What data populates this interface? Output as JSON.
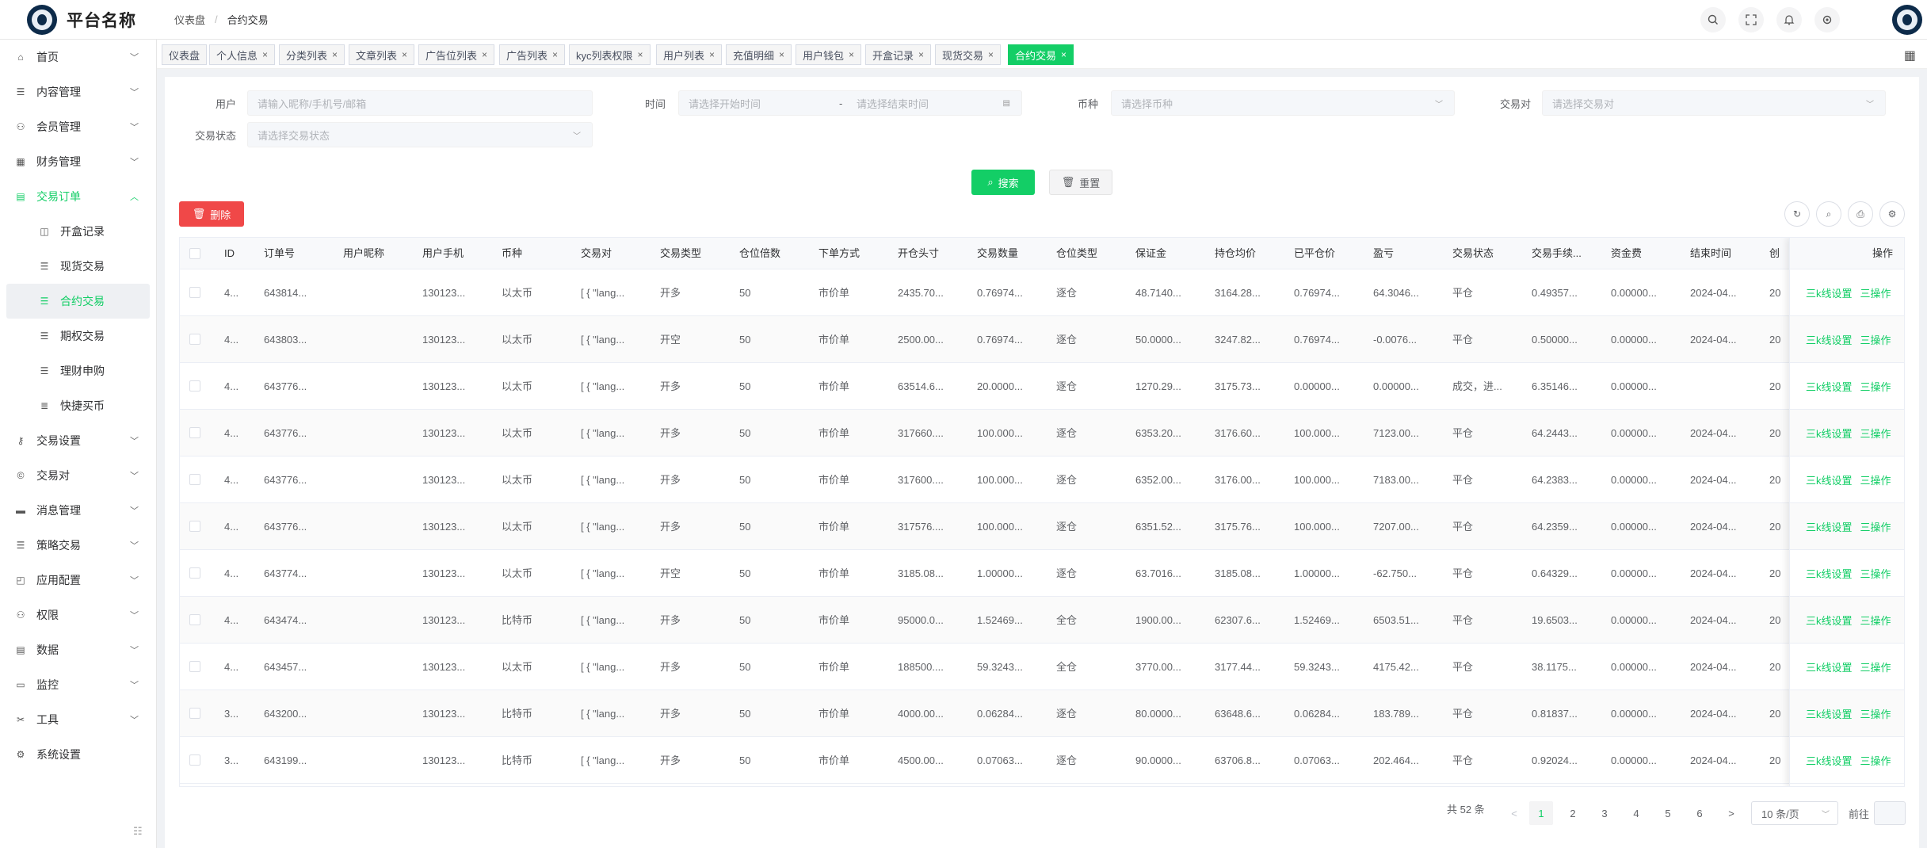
{
  "header": {
    "brand": "平台名称",
    "breadcrumb": [
      "仪表盘",
      "合约交易"
    ],
    "icons": [
      "search-icon",
      "fullscreen-icon",
      "bell-icon",
      "settings-icon"
    ]
  },
  "sidebar": {
    "items": [
      {
        "label": "首页",
        "icon": "home-icon",
        "arrow": "v"
      },
      {
        "label": "内容管理",
        "icon": "list-icon",
        "arrow": "v"
      },
      {
        "label": "会员管理",
        "icon": "user-icon",
        "arrow": "v"
      },
      {
        "label": "财务管理",
        "icon": "finance-icon",
        "arrow": "v"
      },
      {
        "label": "交易订单",
        "icon": "order-icon",
        "arrow": "^"
      }
    ],
    "sub_items": [
      {
        "label": "开盒记录",
        "icon": "box-icon"
      },
      {
        "label": "现货交易",
        "icon": "list-icon"
      },
      {
        "label": "合约交易",
        "icon": "list-icon"
      },
      {
        "label": "期权交易",
        "icon": "list-icon"
      },
      {
        "label": "理财申购",
        "icon": "list-icon"
      },
      {
        "label": "快捷买币",
        "icon": "bars-icon"
      }
    ],
    "items_after": [
      {
        "label": "交易设置",
        "icon": "key-icon",
        "arrow": "v"
      },
      {
        "label": "交易对",
        "icon": "coin-icon",
        "arrow": "v"
      },
      {
        "label": "消息管理",
        "icon": "message-icon",
        "arrow": "v"
      },
      {
        "label": "策略交易",
        "icon": "list-icon",
        "arrow": "v"
      },
      {
        "label": "应用配置",
        "icon": "app-icon",
        "arrow": "v"
      },
      {
        "label": "权限",
        "icon": "permission-icon",
        "arrow": "v"
      },
      {
        "label": "数据",
        "icon": "data-icon",
        "arrow": "v"
      },
      {
        "label": "监控",
        "icon": "monitor-icon",
        "arrow": "v"
      },
      {
        "label": "工具",
        "icon": "tool-icon",
        "arrow": "v"
      },
      {
        "label": "系统设置",
        "icon": "gear-icon",
        "arrow": ""
      }
    ]
  },
  "tags": [
    "仪表盘",
    "个人信息",
    "分类列表",
    "文章列表",
    "广告位列表",
    "广告列表",
    "kyc列表权限",
    "用户列表",
    "充值明细",
    "用户钱包",
    "开盒记录",
    "现货交易",
    "合约交易"
  ],
  "filters": {
    "user_label": "用户",
    "user_placeholder": "请输入昵称/手机号/邮箱",
    "time_label": "时间",
    "time_start": "请选择开始时间",
    "time_sep": "-",
    "time_end": "请选择结束时间",
    "coin_label": "币种",
    "coin_placeholder": "请选择币种",
    "pair_label": "交易对",
    "pair_placeholder": "请选择交易对",
    "status_label": "交易状态",
    "status_placeholder": "请选择交易状态",
    "search": "搜索",
    "reset": "重置",
    "delete": "删除"
  },
  "table": {
    "columns": [
      "ID",
      "订单号",
      "用户昵称",
      "用户手机",
      "币种",
      "交易对",
      "交易类型",
      "仓位倍数",
      "下单方式",
      "开仓头寸",
      "交易数量",
      "仓位类型",
      "保证金",
      "持仓均价",
      "已平仓价",
      "盈亏",
      "交易状态",
      "交易手续...",
      "资金费",
      "结束时间",
      "创"
    ],
    "ops_header": "操作",
    "ops": [
      "三k线设置",
      "三操作"
    ],
    "rows": [
      [
        "4...",
        "643814...",
        "",
        "130123...",
        "以太币",
        "[ { \"lang...",
        "开多",
        "50",
        "市价单",
        "2435.70...",
        "0.76974...",
        "逐仓",
        "48.7140...",
        "3164.28...",
        "0.76974...",
        "64.3046...",
        "平仓",
        "0.49357...",
        "0.00000...",
        "2024-04...",
        "20"
      ],
      [
        "4...",
        "643803...",
        "",
        "130123...",
        "以太币",
        "[ { \"lang...",
        "开空",
        "50",
        "市价单",
        "2500.00...",
        "0.76974...",
        "逐仓",
        "50.0000...",
        "3247.82...",
        "0.76974...",
        "-0.0076...",
        "平仓",
        "0.50000...",
        "0.00000...",
        "2024-04...",
        "20"
      ],
      [
        "4...",
        "643776...",
        "",
        "130123...",
        "以太币",
        "[ { \"lang...",
        "开多",
        "50",
        "市价单",
        "63514.6...",
        "20.0000...",
        "逐仓",
        "1270.29...",
        "3175.73...",
        "0.00000...",
        "0.00000...",
        "成交，进...",
        "6.35146...",
        "0.00000...",
        "",
        "20"
      ],
      [
        "4...",
        "643776...",
        "",
        "130123...",
        "以太币",
        "[ { \"lang...",
        "开多",
        "50",
        "市价单",
        "317660....",
        "100.000...",
        "逐仓",
        "6353.20...",
        "3176.60...",
        "100.000...",
        "7123.00...",
        "平仓",
        "64.2443...",
        "0.00000...",
        "2024-04...",
        "20"
      ],
      [
        "4...",
        "643776...",
        "",
        "130123...",
        "以太币",
        "[ { \"lang...",
        "开多",
        "50",
        "市价单",
        "317600....",
        "100.000...",
        "逐仓",
        "6352.00...",
        "3176.00...",
        "100.000...",
        "7183.00...",
        "平仓",
        "64.2383...",
        "0.00000...",
        "2024-04...",
        "20"
      ],
      [
        "4...",
        "643776...",
        "",
        "130123...",
        "以太币",
        "[ { \"lang...",
        "开多",
        "50",
        "市价单",
        "317576....",
        "100.000...",
        "逐仓",
        "6351.52...",
        "3175.76...",
        "100.000...",
        "7207.00...",
        "平仓",
        "64.2359...",
        "0.00000...",
        "2024-04...",
        "20"
      ],
      [
        "4...",
        "643774...",
        "",
        "130123...",
        "以太币",
        "[ { \"lang...",
        "开空",
        "50",
        "市价单",
        "3185.08...",
        "1.00000...",
        "逐仓",
        "63.7016...",
        "3185.08...",
        "1.00000...",
        "-62.750...",
        "平仓",
        "0.64329...",
        "0.00000...",
        "2024-04...",
        "20"
      ],
      [
        "4...",
        "643474...",
        "",
        "130123...",
        "比特币",
        "[ { \"lang...",
        "开多",
        "50",
        "市价单",
        "95000.0...",
        "1.52469...",
        "全仓",
        "1900.00...",
        "62307.6...",
        "1.52469...",
        "6503.51...",
        "平仓",
        "19.6503...",
        "0.00000...",
        "2024-04...",
        "20"
      ],
      [
        "4...",
        "643457...",
        "",
        "130123...",
        "以太币",
        "[ { \"lang...",
        "开多",
        "50",
        "市价单",
        "188500....",
        "59.3243...",
        "全仓",
        "3770.00...",
        "3177.44...",
        "59.3243...",
        "4175.42...",
        "平仓",
        "38.1175...",
        "0.00000...",
        "2024-04...",
        "20"
      ],
      [
        "3...",
        "643200...",
        "",
        "130123...",
        "比特币",
        "[ { \"lang...",
        "开多",
        "50",
        "市价单",
        "4000.00...",
        "0.06284...",
        "逐仓",
        "80.0000...",
        "63648.6...",
        "0.06284...",
        "183.789...",
        "平仓",
        "0.81837...",
        "0.00000...",
        "2024-04...",
        "20"
      ],
      [
        "3...",
        "643199...",
        "",
        "130123...",
        "比特币",
        "[ { \"lang...",
        "开多",
        "50",
        "市价单",
        "4500.00...",
        "0.07063...",
        "逐仓",
        "90.0000...",
        "63706.8...",
        "0.07063...",
        "202.464...",
        "平仓",
        "0.92024...",
        "0.00000...",
        "2024-04...",
        "20"
      ]
    ]
  },
  "pagination": {
    "total": "共 52 条",
    "pages": [
      "1",
      "2",
      "3",
      "4",
      "5",
      "6"
    ],
    "prev": "<",
    "next": ">",
    "page_size": "10 条/页",
    "goto": "前往"
  },
  "colors": {
    "accent": "#13ce66",
    "danger": "#f04848"
  }
}
